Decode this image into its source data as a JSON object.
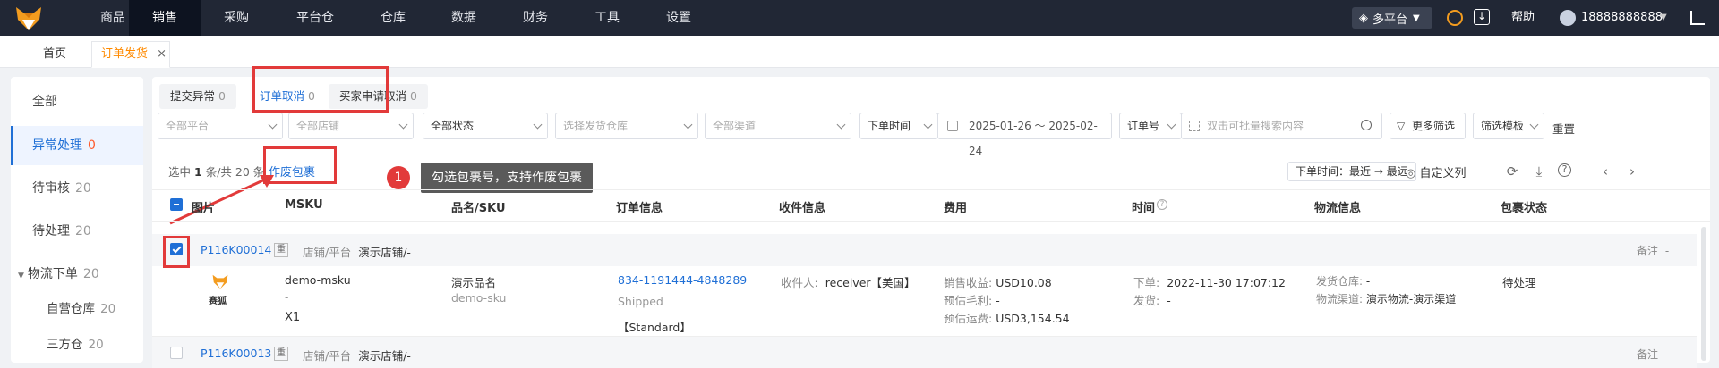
{
  "topbar": {
    "nav": [
      "商品",
      "销售",
      "采购",
      "平台仓",
      "仓库",
      "数据",
      "财务",
      "工具",
      "设置"
    ],
    "active_nav": "销售",
    "platform": "多平台",
    "help": "帮助",
    "user": "18888888888"
  },
  "tabs": [
    {
      "label": "首页"
    },
    {
      "label": "订单发货",
      "close": "×"
    }
  ],
  "sidebar": {
    "items": [
      {
        "label": "全部",
        "count": ""
      },
      {
        "label": "异常处理",
        "count": "0"
      },
      {
        "label": "待审核",
        "count": "20"
      },
      {
        "label": "待处理",
        "count": "20"
      },
      {
        "label": "物流下单",
        "count": "20"
      },
      {
        "label": "自营仓库",
        "count": "20"
      },
      {
        "label": "三方仓",
        "count": "20"
      }
    ]
  },
  "subtabs": [
    {
      "label": "提交异常",
      "count": "0"
    },
    {
      "label": "订单取消",
      "count": "0"
    },
    {
      "label": "买家申请取消",
      "count": "0"
    }
  ],
  "filters": {
    "platform": "全部平台",
    "shop": "全部店铺",
    "status": "全部状态",
    "warehouse": "选择发货仓库",
    "channel": "全部渠道",
    "time_type": "下单时间",
    "date_range": "2025-01-26 ～ 2025-02-24",
    "order_field": "订单号",
    "search_placeholder": "双击可批量搜索内容",
    "more": "更多筛选",
    "template": "筛选模板",
    "reset": "重置"
  },
  "toolbar": {
    "selected_prefix": "选中",
    "selected": "1",
    "selected_mid": "条/共",
    "total": "20",
    "selected_suffix": "条",
    "void_button": "作废包裹",
    "sort": "下单时间：最近 → 最远",
    "custom_columns": "自定义列"
  },
  "callout": {
    "num": "1",
    "text": "勾选包裹号，支持作废包裹"
  },
  "table": {
    "headers": [
      "图片",
      "MSKU",
      "品名/SKU",
      "订单信息",
      "收件信息",
      "费用",
      "时间",
      "物流信息",
      "包裹状态"
    ],
    "rows": [
      {
        "package_id": "P116K00014",
        "dup": "重",
        "shop_label": "店铺/平台",
        "shop": "演示店铺/-",
        "note_label": "备注",
        "note": "-",
        "img_text": "赛狐",
        "msku": "demo-msku",
        "msku_sub": "-",
        "qty": "X1",
        "name": "演示品名",
        "sku": "demo-sku",
        "order_no": "834-1191444-4848289",
        "order_status": "Shipped",
        "order_type": "【Standard】",
        "receiver_label": "收件人:",
        "receiver": "receiver【美国】",
        "fee_revenue_label": "销售收益:",
        "fee_revenue": "USD10.08",
        "fee_profit_label": "预估毛利:",
        "fee_profit": "-",
        "fee_ship_label": "预估运费:",
        "fee_ship": "USD3,154.54",
        "order_time_label": "下单:",
        "order_time": "2022-11-30 17:07:12",
        "ship_time_label": "发货:",
        "ship_time": "-",
        "wh_label": "发货仓库:",
        "wh": "-",
        "ch_label": "物流渠道:",
        "ch": "演示物流-演示渠道",
        "status": "待处理"
      },
      {
        "package_id": "P116K00013",
        "dup": "重",
        "shop_label": "店铺/平台",
        "shop": "演示店铺/-",
        "note_label": "备注",
        "note": "-"
      }
    ]
  },
  "colors": {
    "accent": "#1f6fd6",
    "orange": "#ff8a00",
    "highlight": "#e23a3a",
    "topbar": "#212735"
  }
}
